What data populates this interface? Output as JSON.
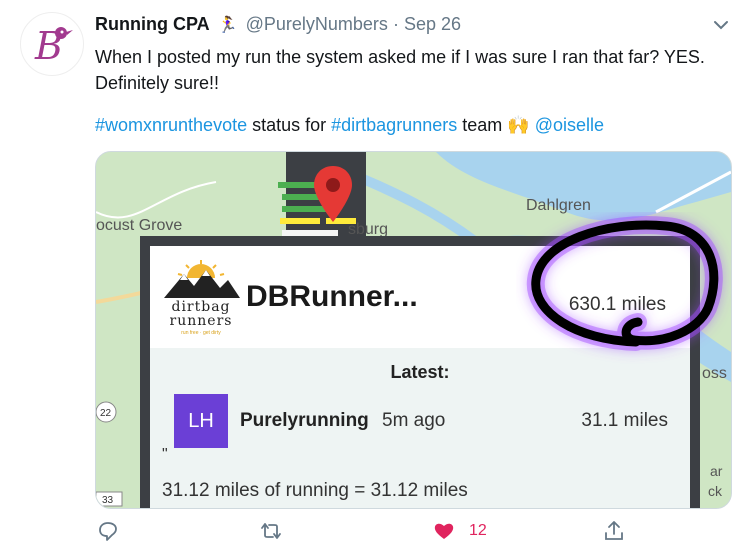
{
  "tweet": {
    "display_name": "Running CPA",
    "name_emoji": "🏃‍♀️",
    "handle": "@PurelyNumbers",
    "separator": "·",
    "date": "Sep 26",
    "text_line1": "When I posted my run the system asked me if I was sure I ran that far? YES. Definitely sure!!",
    "hashtag1": "#womxnrunthevote",
    "mid1": " status for ",
    "hashtag2": "#dirtbagrunners",
    "mid2": " team ",
    "mention": "@oiselle",
    "praise_emoji": "🙌"
  },
  "media": {
    "map_labels": {
      "locust_grove": "ocust Grove",
      "burg": "sburg",
      "dahlgren": "Dahlgren",
      "oss": "oss",
      "ar": "ar",
      "ck": "ck",
      "route_22": "22",
      "route_33": "33"
    },
    "card": {
      "logo_line1": "dirtbag",
      "logo_line2": "runners",
      "logo_sub": "run free · get dirty",
      "title": "DBRunner...",
      "total_miles": "630.1 miles",
      "latest_label": "Latest:",
      "badge": "LH",
      "runner_name": "Purelyrunning",
      "time_ago": "5m ago",
      "run_miles": "31.1 miles",
      "quote_mark": "\"",
      "description": "31.12 miles of running = 31.12 miles"
    }
  },
  "actions": {
    "like_count": "12"
  },
  "colors": {
    "link": "#1b95e0",
    "like": "#e0245e",
    "badge": "#6b3fd6",
    "map_water": "#a8d3ee",
    "map_land": "#cfe6c4",
    "annotation": "#000000",
    "annotation_glow": "#a24cff"
  },
  "icons": [
    "bird-avatar-icon",
    "runner-emoji-icon",
    "chevron-down-icon",
    "raised-hands-icon",
    "map-pin-icon",
    "reply-icon",
    "retweet-icon",
    "heart-icon",
    "share-icon"
  ]
}
